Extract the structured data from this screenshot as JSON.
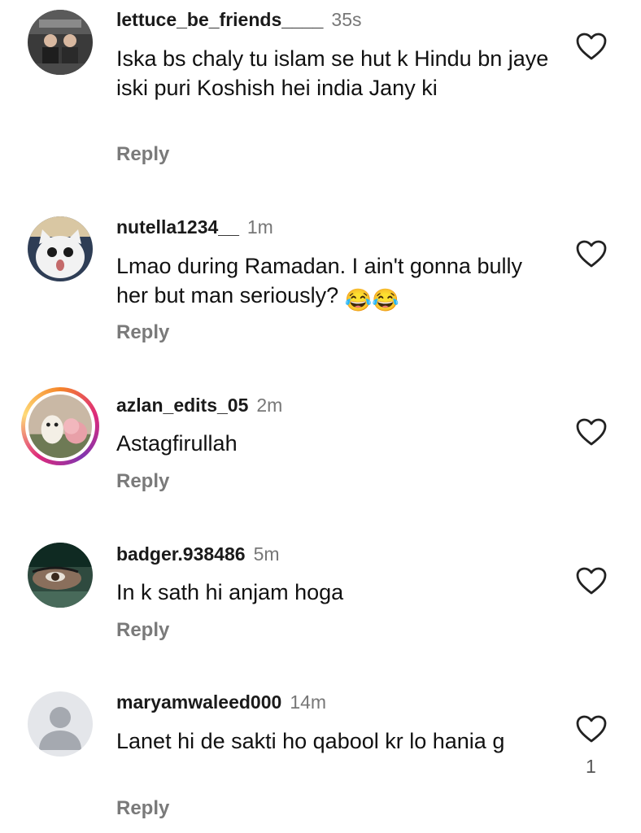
{
  "comments": [
    {
      "username": "lettuce_be_friends____",
      "time": "35s",
      "text": "Iska bs chaly tu islam se hut k Hindu bn jaye iski puri Koshish hei india Jany ki",
      "reply": "Reply"
    },
    {
      "username": "nutella1234__",
      "time": "1m",
      "text": "Lmao during Ramadan. I ain't gonna bully her but man seriously?",
      "emoji": "😂😂",
      "reply": "Reply"
    },
    {
      "username": "azlan_edits_05",
      "time": "2m",
      "text": "Astagfirullah",
      "reply": "Reply"
    },
    {
      "username": "badger.938486",
      "time": "5m",
      "text": "In k sath hi anjam hoga",
      "reply": "Reply"
    },
    {
      "username": "maryamwaleed000",
      "time": "14m",
      "text": "Lanet hi de sakti ho qabool kr lo hania g",
      "reply": "Reply",
      "like_count": "1"
    }
  ],
  "icons": {
    "like": "heart-outline-icon",
    "default_avatar": "person-placeholder-icon"
  }
}
